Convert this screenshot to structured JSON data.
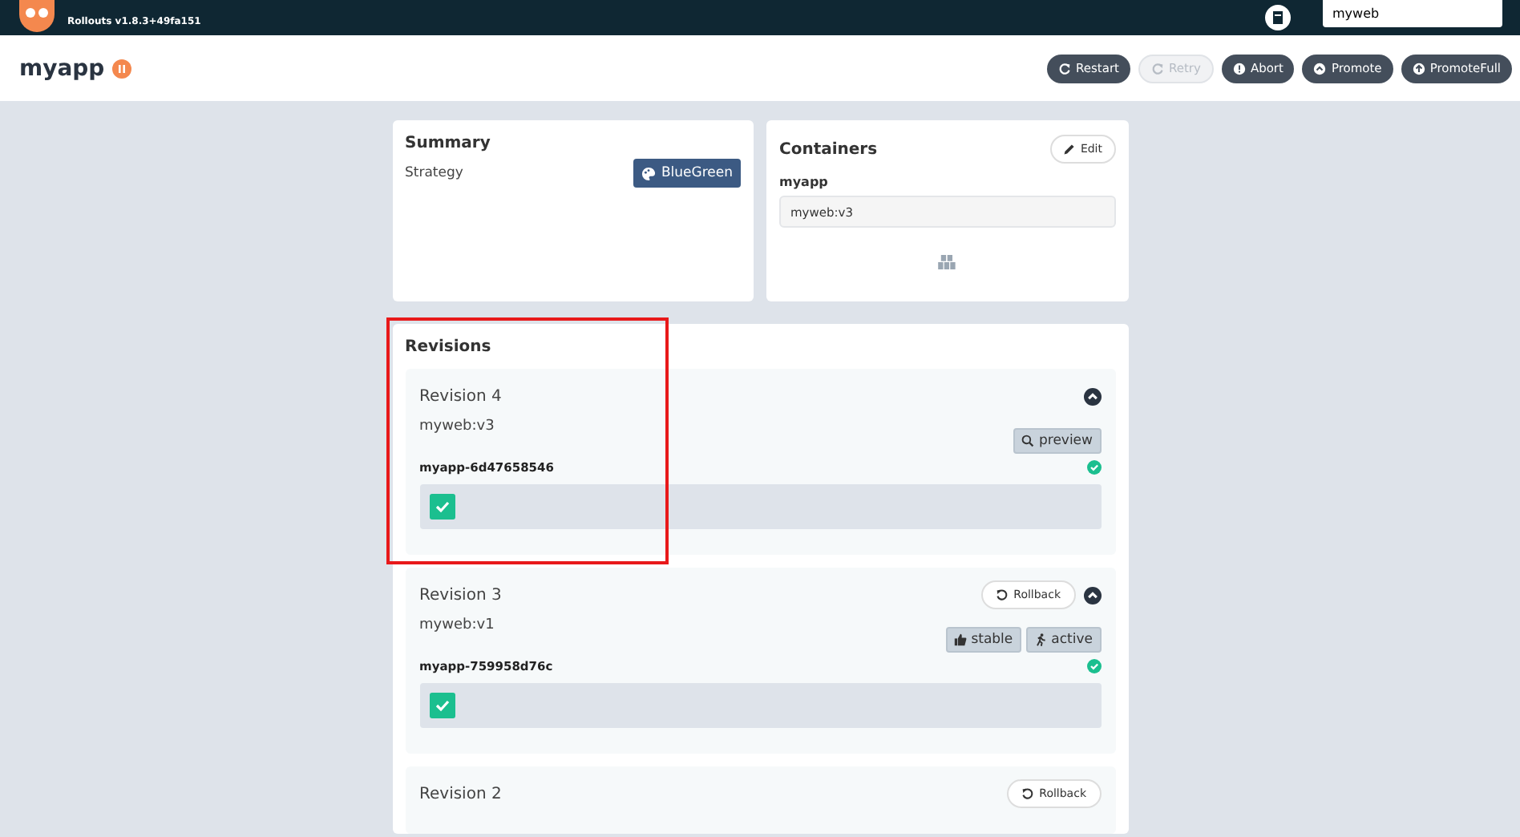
{
  "top_bar": {
    "version": "Rollouts v1.8.3+49fa151",
    "search": {
      "value": "myweb"
    }
  },
  "app": {
    "name": "myapp"
  },
  "actions": [
    {
      "label": "Restart",
      "disabled": false
    },
    {
      "label": "Retry",
      "disabled": true
    },
    {
      "label": "Abort",
      "disabled": false
    },
    {
      "label": "Promote",
      "disabled": false
    },
    {
      "label": "PromoteFull",
      "disabled": false
    }
  ],
  "summary": {
    "title": "Summary",
    "rows": [
      {
        "label": "Strategy",
        "value": "BlueGreen"
      }
    ]
  },
  "containers": {
    "title": "Containers",
    "edit_label": "Edit",
    "items": [
      {
        "name": "myapp",
        "image": "myweb:v3"
      }
    ]
  },
  "revisions": {
    "title": "Revisions",
    "items": [
      {
        "title": "Revision 4",
        "image": "myweb:v3",
        "pod": "myapp-6d47658546",
        "expanded": true,
        "badges": [
          {
            "kind": "preview",
            "label": "preview"
          }
        ]
      },
      {
        "title": "Revision 3",
        "image": "myweb:v1",
        "pod": "myapp-759958d76c",
        "expanded": true,
        "rollback": "Rollback",
        "badges": [
          {
            "kind": "stable",
            "label": "stable"
          },
          {
            "kind": "active",
            "label": "active"
          }
        ]
      },
      {
        "title": "Revision 2",
        "rollback": "Rollback"
      }
    ]
  }
}
